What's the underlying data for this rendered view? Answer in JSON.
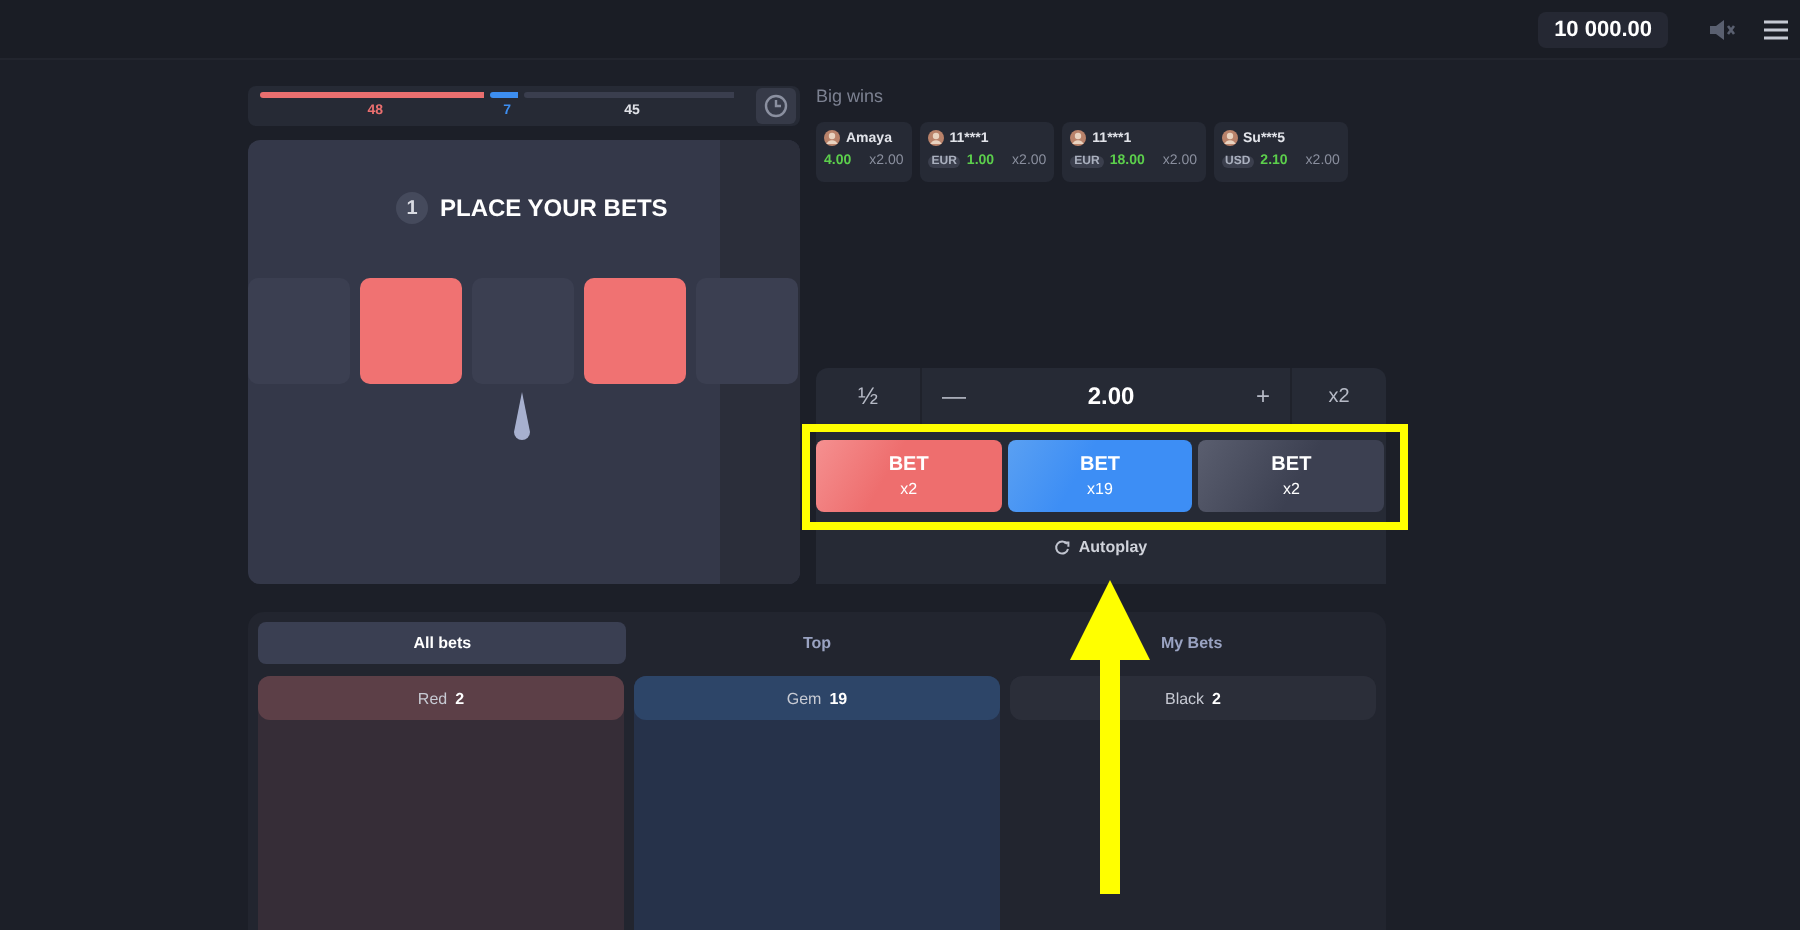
{
  "top_bar": {
    "balance": "10 000.00"
  },
  "stats": {
    "segments": [
      {
        "value": "48",
        "color": "#ea6f6f"
      },
      {
        "value": "7",
        "color": "#3d8ef0"
      },
      {
        "value": "45",
        "color": "#3a3e4e"
      }
    ]
  },
  "game": {
    "round": "1",
    "title": "PLACE YOUR BETS",
    "tiles": [
      {
        "kind": "black"
      },
      {
        "kind": "red"
      },
      {
        "kind": "black"
      },
      {
        "kind": "red"
      },
      {
        "kind": "black"
      }
    ]
  },
  "big_wins": {
    "title": "Big wins",
    "wins": [
      {
        "player": "Amaya",
        "amount": "4.00",
        "multiplier": "x2.00"
      },
      {
        "player": "11***1",
        "currency": "EUR",
        "amount": "1.00",
        "multiplier": "x2.00"
      },
      {
        "player": "11***1",
        "currency": "EUR",
        "amount": "18.00",
        "multiplier": "x2.00"
      },
      {
        "player": "Su***5",
        "currency": "USD",
        "amount": "2.10",
        "multiplier": "x2.00"
      }
    ]
  },
  "bet_panel": {
    "half": "½",
    "minus": "—",
    "amount": "2.00",
    "plus": "+",
    "double": "x2",
    "bets": [
      {
        "kind": "red",
        "label": "BET",
        "payout": "x2"
      },
      {
        "kind": "gem",
        "label": "BET",
        "payout": "x19"
      },
      {
        "kind": "black",
        "label": "BET",
        "payout": "x2"
      }
    ],
    "autoplay": "Autoplay",
    "highlighted": true
  },
  "bets_board": {
    "tabs": [
      {
        "label": "All bets",
        "selected": true
      },
      {
        "label": "Top",
        "selected": false
      },
      {
        "label": "My Bets",
        "selected": false
      }
    ],
    "columns": [
      {
        "kind": "red",
        "name": "Red",
        "count": "2"
      },
      {
        "kind": "gem",
        "name": "Gem",
        "count": "19"
      },
      {
        "kind": "black",
        "name": "Black",
        "count": "2"
      }
    ]
  },
  "pointer_arrow": true
}
